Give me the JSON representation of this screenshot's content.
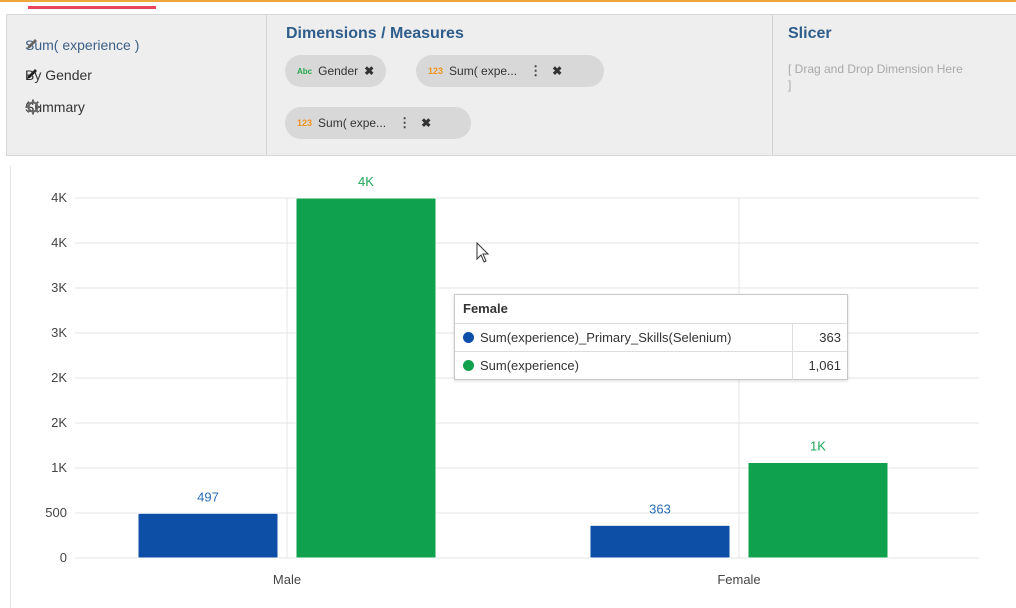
{
  "sidebar": {
    "items": [
      {
        "label": "Sum( experience )",
        "icon": "pencil-icon"
      },
      {
        "label": "By Gender",
        "icon": "pencil-icon"
      },
      {
        "label": "Summary",
        "icon": "gear-icon"
      }
    ]
  },
  "dimensions_measures": {
    "title": "Dimensions / Measures",
    "pills": [
      {
        "type_tag": "Abc",
        "label": "Gender"
      },
      {
        "type_tag": "123",
        "label": "Sum( expe..."
      },
      {
        "type_tag": "123",
        "label": "Sum( expe..."
      }
    ]
  },
  "slicer": {
    "title": "Slicer",
    "placeholder_line1": "[ Drag and Drop Dimension Here",
    "placeholder_line2": "]"
  },
  "colors": {
    "series1": "#0d4fa6",
    "series2": "#0fa14e",
    "accent_orange": "#f0a53a",
    "accent_red": "#e8455a"
  },
  "chart_data": {
    "type": "bar",
    "categories": [
      "Male",
      "Female"
    ],
    "series": [
      {
        "name": "Sum(experience)_Primary_Skills(Selenium)",
        "values": [
          497,
          363
        ],
        "labels": [
          "497",
          "363"
        ]
      },
      {
        "name": "Sum(experience)",
        "values": [
          4000,
          1061
        ],
        "labels": [
          "4K",
          "1K"
        ]
      }
    ],
    "y_ticks": [
      "0",
      "500",
      "1K",
      "2K",
      "2K",
      "3K",
      "3K",
      "4K",
      "4K"
    ],
    "ylim": [
      0,
      4000
    ],
    "grid": true
  },
  "tooltip": {
    "title": "Female",
    "rows": [
      {
        "name": "Sum(experience)_Primary_Skills(Selenium)",
        "value": "363"
      },
      {
        "name": "Sum(experience)",
        "value": "1,061"
      }
    ]
  }
}
